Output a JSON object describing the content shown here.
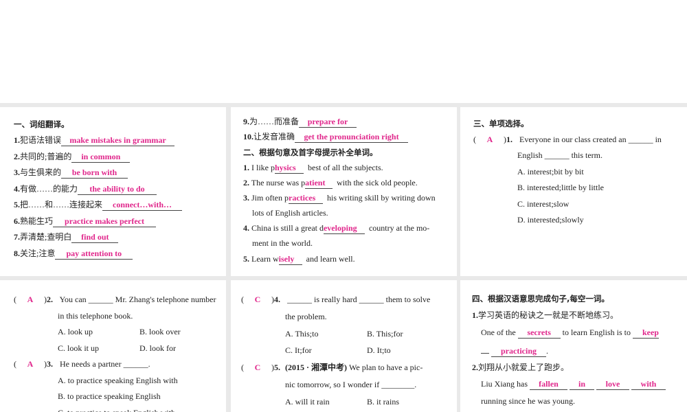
{
  "colors": {
    "answer": "#e0268b",
    "background": "#e9e9e9"
  },
  "section1": {
    "title": "一、词组翻译。",
    "items": [
      {
        "num": "1.",
        "cn": "犯语法错误",
        "ans": "make mistakes in grammar"
      },
      {
        "num": "2.",
        "cn": "共同的;普遍的",
        "ans": "in common"
      },
      {
        "num": "3.",
        "cn": "与生俱来的",
        "ans": "be born with"
      },
      {
        "num": "4.",
        "cn": "有做……的能力",
        "ans": "the ability to do"
      },
      {
        "num": "5.",
        "cn": "把……和……连接起来",
        "ans": "connect…with…"
      },
      {
        "num": "6.",
        "cn": "熟能生巧",
        "ans": "practice makes perfect"
      },
      {
        "num": "7.",
        "cn": "弄清楚;查明白",
        "ans": "find out"
      },
      {
        "num": "8.",
        "cn": "关注;注意",
        "ans": "pay attention to"
      },
      {
        "num": "9.",
        "cn": "为……而准备",
        "ans": "prepare for"
      },
      {
        "num": "10.",
        "cn": "让发音准确",
        "ans": "get the pronunciation right"
      }
    ]
  },
  "section2": {
    "title": "二、根据句意及首字母提示补全单词。",
    "items": [
      {
        "num": "1.",
        "pre": "I like p",
        "ans": "hysics",
        "post": "best of all the subjects."
      },
      {
        "num": "2.",
        "pre": "The nurse was p",
        "ans": "atient",
        "post": "with the sick old people."
      },
      {
        "num": "3.",
        "pre": "Jim often p",
        "ans": "ractices",
        "post": "his writing skill by writing down",
        "cont": "lots of English articles."
      },
      {
        "num": "4.",
        "pre": "China is still a great d",
        "ans": "eveloping",
        "post": "country at the mo-",
        "cont": "ment in the world."
      },
      {
        "num": "5.",
        "pre": "Learn w",
        "ans": "isely",
        "post": "and learn well."
      }
    ]
  },
  "section3": {
    "title": "三、单项选择。",
    "questions": [
      {
        "answer": "A",
        "num": "1.",
        "l1": "Everyone in our class created an ______ in",
        "l2": "English ______ this term.",
        "options": [
          "A. interest;bit by bit",
          "B. interested;little by little",
          "C. interest;slow",
          "D. interested;slowly"
        ]
      },
      {
        "answer": "A",
        "num": "2.",
        "l1": "You can ______ Mr. Zhang's telephone number",
        "l2": "in this telephone book.",
        "options": [
          "A. look up",
          "B. look over",
          "C. look it up",
          "D. look for"
        ]
      },
      {
        "answer": "A",
        "num": "3.",
        "l1": "He needs a partner ______.",
        "options": [
          "A. to practice speaking English with",
          "B. to practice speaking English",
          "C. to practice to speak English with"
        ]
      },
      {
        "answer": "C",
        "num": "4.",
        "l1": "______ is really hard ______ them to solve",
        "l2": "the problem.",
        "options": [
          "A. This;to",
          "B. This;for",
          "C. It;for",
          "D. It;to"
        ]
      },
      {
        "answer": "C",
        "num": "5.",
        "src": "(2015 · 湘潭中考)",
        "l1": "We plan to have a pic-",
        "l2": "nic tomorrow, so I wonder if ________.",
        "options": [
          "A. will it rain",
          "B. it rains"
        ]
      }
    ]
  },
  "section4": {
    "title": "四、根据汉语意思完成句子,每空一词。",
    "items": [
      {
        "num": "1.",
        "cn": "学习英语的秘诀之一就是不断地练习。",
        "pre": "One of the",
        "a1": "secrets",
        "mid": "to learn English is to",
        "a2": "keep",
        "a3": "practicing",
        "end": "."
      },
      {
        "num": "2.",
        "cn": "刘翔从小就爱上了跑步。",
        "pre": "Liu Xiang has",
        "a": [
          "fallen",
          "in",
          "love",
          "with"
        ],
        "cont": "running since he was young."
      }
    ]
  }
}
